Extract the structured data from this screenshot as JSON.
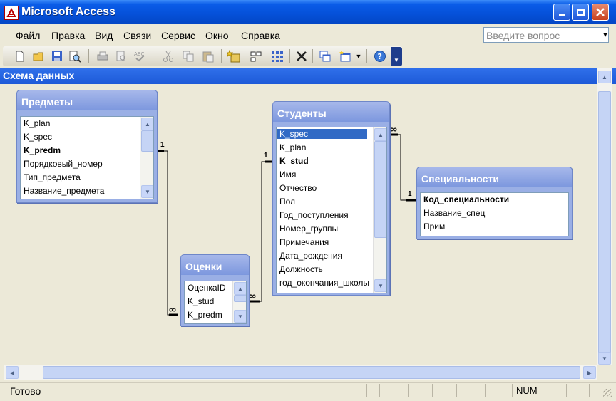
{
  "window": {
    "title": "Microsoft Access"
  },
  "menu": {
    "items": [
      "Файл",
      "Правка",
      "Вид",
      "Связи",
      "Сервис",
      "Окно",
      "Справка"
    ],
    "question_placeholder": "Введите вопрос"
  },
  "toolbar": {
    "icons": [
      "new-icon",
      "open-icon",
      "save-icon",
      "file-search-icon",
      "print-icon",
      "print-preview-icon",
      "spelling-icon",
      "cut-icon",
      "copy-icon",
      "paste-icon",
      "show-table-icon",
      "show-direct-icon",
      "show-all-icon",
      "delete-icon",
      "new-object-icon",
      "database-window-icon",
      "dropdown-icon",
      "help-icon"
    ]
  },
  "child_window": {
    "title": "Схема данных"
  },
  "tables": {
    "predmety": {
      "title": "Предметы",
      "fields": [
        {
          "name": "K_plan",
          "key": false,
          "selected": false
        },
        {
          "name": "K_spec",
          "key": false,
          "selected": false
        },
        {
          "name": "K_predm",
          "key": true,
          "selected": false
        },
        {
          "name": "Порядковый_номер",
          "key": false,
          "selected": false
        },
        {
          "name": "Тип_предмета",
          "key": false,
          "selected": false
        },
        {
          "name": "Название_предмета",
          "key": false,
          "selected": false
        }
      ]
    },
    "studenty": {
      "title": "Студенты",
      "fields": [
        {
          "name": "K_spec",
          "key": false,
          "selected": true
        },
        {
          "name": "K_plan",
          "key": false,
          "selected": false
        },
        {
          "name": "K_stud",
          "key": true,
          "selected": false
        },
        {
          "name": "Имя",
          "key": false,
          "selected": false
        },
        {
          "name": "Отчество",
          "key": false,
          "selected": false
        },
        {
          "name": "Пол",
          "key": false,
          "selected": false
        },
        {
          "name": "Год_поступления",
          "key": false,
          "selected": false
        },
        {
          "name": "Номер_группы",
          "key": false,
          "selected": false
        },
        {
          "name": "Примечания",
          "key": false,
          "selected": false
        },
        {
          "name": "Дата_рождения",
          "key": false,
          "selected": false
        },
        {
          "name": "Должность",
          "key": false,
          "selected": false
        },
        {
          "name": "год_окончания_школы",
          "key": false,
          "selected": false
        }
      ]
    },
    "specialnosti": {
      "title": "Специальности",
      "fields": [
        {
          "name": "Код_специальности",
          "key": true,
          "selected": false
        },
        {
          "name": "Название_спец",
          "key": false,
          "selected": false
        },
        {
          "name": "Прим",
          "key": false,
          "selected": false
        }
      ]
    },
    "ocenki": {
      "title": "Оценки",
      "fields": [
        {
          "name": "ОценкаID",
          "key": false,
          "selected": false
        },
        {
          "name": "K_stud",
          "key": false,
          "selected": false
        },
        {
          "name": "K_predm",
          "key": false,
          "selected": false
        }
      ]
    }
  },
  "relationships": [
    {
      "one_label": "1",
      "many_label": "∞",
      "from": "Предметы.K_predm",
      "to": "Оценки.K_predm"
    },
    {
      "one_label": "1",
      "many_label": "∞",
      "from": "Студенты.K_stud",
      "to": "Оценки.K_stud"
    },
    {
      "one_label": "1",
      "many_label": "∞",
      "from": "Специальности.Код_специальности",
      "to": "Студенты.K_spec"
    }
  ],
  "status": {
    "text": "Готово",
    "num": "NUM"
  },
  "colors": {
    "title_blue": "#0550D8",
    "selection": "#316AC5",
    "table_header": "#7C97DE"
  }
}
